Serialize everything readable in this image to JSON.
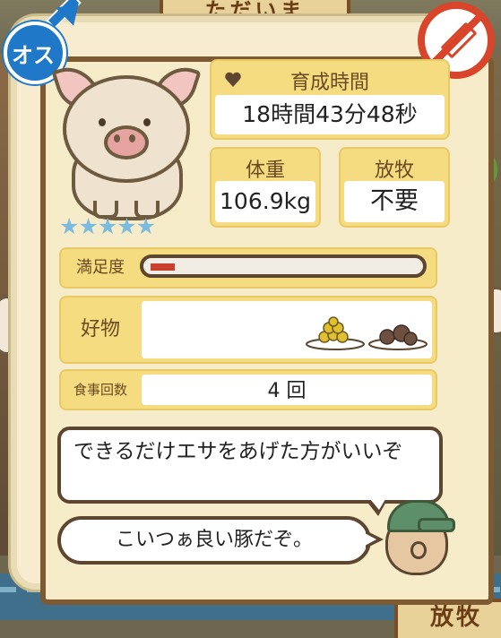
{
  "background": {
    "top_sign": "ただいま",
    "bottom_sign": "放牧"
  },
  "badges": {
    "gender_label": "オス",
    "gender_icon": "male-symbol-icon",
    "medicine_icon": "no-syringe-icon"
  },
  "pig": {
    "stars": "★★★★★",
    "rating": 5,
    "rating_max": 5
  },
  "stats": {
    "rearing_time": {
      "label": "育成時間",
      "value": "18時間43分48秒"
    },
    "weight": {
      "label": "体重",
      "value": "106.9kg"
    },
    "grazing": {
      "label": "放牧",
      "value": "不要"
    }
  },
  "satisfaction": {
    "label": "満足度",
    "fraction": 0.09
  },
  "favorites": {
    "label": "好物",
    "items": [
      "soybeans-icon",
      "chestnuts-icon"
    ]
  },
  "meals": {
    "label": "食事回数",
    "value": "4 回"
  },
  "dialog": {
    "advice": "できるだけエサをあげた方がいいぞ",
    "comment": "こいつぁ良い豚だぞ。"
  },
  "colors": {
    "gender_blue": "#1f78c8",
    "no_med_red": "#d8452a",
    "star_blue": "#7cbbe0",
    "satisfaction_red": "#c9412e",
    "label_yellow": "#f6dc80"
  }
}
